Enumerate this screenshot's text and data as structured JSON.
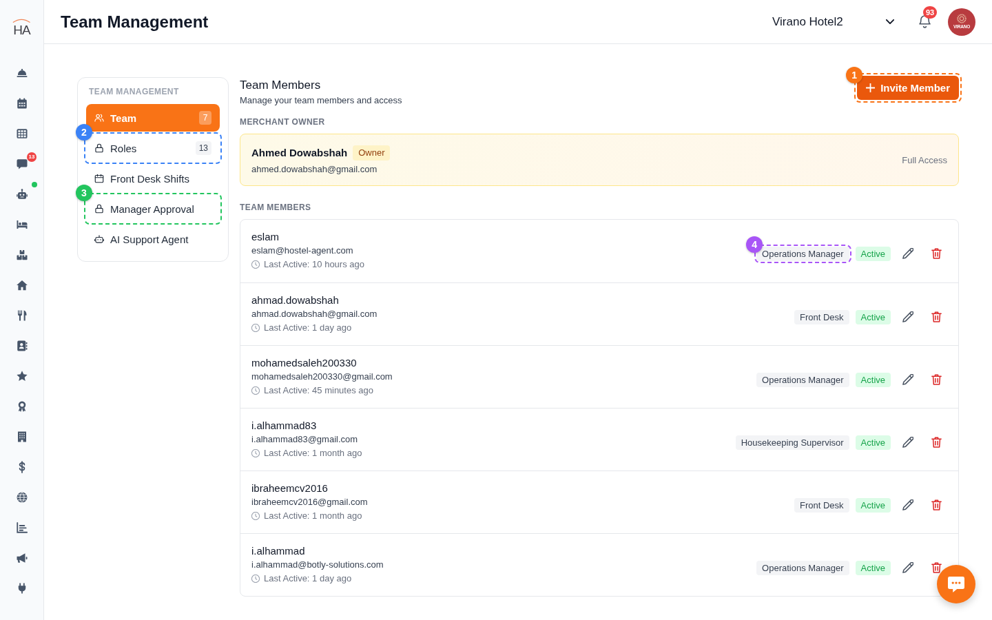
{
  "rail": {
    "logo_text": "HA",
    "messages_badge": "13",
    "assistant_online": true
  },
  "header": {
    "title": "Team Management",
    "property_selector": "Virano Hotel2",
    "notifications_count": "93",
    "logo_text": "VIRANO"
  },
  "settings_menu": {
    "heading": "TEAM MANAGEMENT",
    "items": [
      {
        "label": "Team",
        "count": "7",
        "selected": true
      },
      {
        "label": "Roles",
        "count": "13",
        "selected": false,
        "highlight": {
          "number": "2",
          "color": "#3b82f6"
        }
      },
      {
        "label": "Front Desk Shifts",
        "selected": false
      },
      {
        "label": "Manager Approval",
        "selected": false,
        "highlight": {
          "number": "3",
          "color": "#22c55e"
        }
      },
      {
        "label": "AI Support Agent",
        "selected": false
      }
    ]
  },
  "team_members": {
    "title": "Team Members",
    "subtitle": "Manage your team members and access",
    "invite_button": {
      "label": "Invite Member",
      "highlight": {
        "number": "1",
        "color": "#f97316"
      }
    },
    "owner_section": {
      "heading": "MERCHANT OWNER",
      "name": "Ahmed Dowabshah",
      "badge": "Owner",
      "email": "ahmed.dowabshah@gmail.com",
      "access": "Full Access"
    },
    "members_heading": "TEAM MEMBERS",
    "members": [
      {
        "name": "eslam",
        "email": "eslam@hostel-agent.com",
        "last_active": "Last Active: 10 hours ago",
        "role": "Operations Manager",
        "status": "Active",
        "highlight": {
          "number": "4",
          "color": "#a855f7"
        }
      },
      {
        "name": "ahmad.dowabshah",
        "email": "ahmad.dowabshah@gmail.com",
        "last_active": "Last Active: 1 day ago",
        "role": "Front Desk",
        "status": "Active"
      },
      {
        "name": "mohamedsaleh200330",
        "email": "mohamedsaleh200330@gmail.com",
        "last_active": "Last Active: 45 minutes ago",
        "role": "Operations Manager",
        "status": "Active"
      },
      {
        "name": "i.alhammad83",
        "email": "i.alhammad83@gmail.com",
        "last_active": "Last Active: 1 month ago",
        "role": "Housekeeping Supervisor",
        "status": "Active"
      },
      {
        "name": "ibraheemcv2016",
        "email": "ibraheemcv2016@gmail.com",
        "last_active": "Last Active: 1 month ago",
        "role": "Front Desk",
        "status": "Active"
      },
      {
        "name": "i.alhammad",
        "email": "i.alhammad@botly-solutions.com",
        "last_active": "Last Active: 1 day ago",
        "role": "Operations Manager",
        "status": "Active"
      }
    ]
  }
}
